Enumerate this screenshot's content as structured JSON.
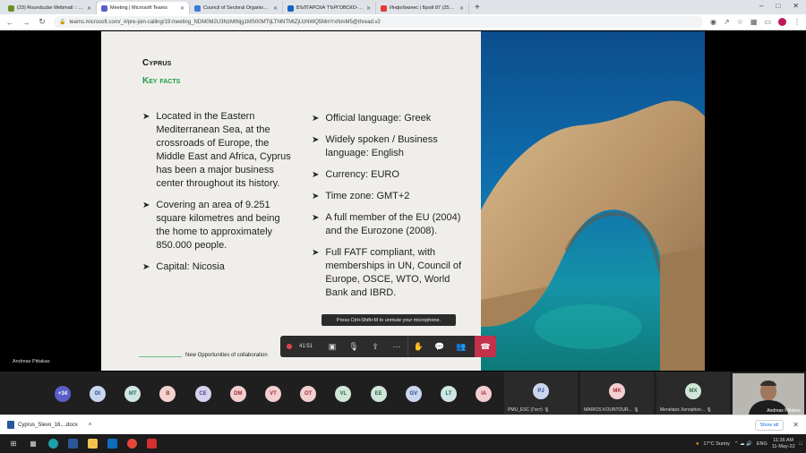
{
  "browser": {
    "tabs": [
      {
        "title": "(23) Roundcube Webmail :: Inbox",
        "color": "#6b8e23"
      },
      {
        "title": "Meeting | Microsoft Teams",
        "color": "#5b5fc7",
        "active": true
      },
      {
        "title": "Council of Sectoral Organisation...",
        "color": "#3a7bd5"
      },
      {
        "title": "БЪЛГАРСКА ТЪРГОВСКО-ПРОМ...",
        "color": "#1565c0"
      },
      {
        "title": "Инфобизнес | Брой 87 (2591) - ...",
        "color": "#e53935"
      }
    ],
    "new_tab": "+",
    "url": "teams.microsoft.com/_#/pre-join-calling/19:meeting_NDM0M2U3NzMtNjg1MS00MTljLThlNTMtZjUzNWQ5MmYxNmM5@thread.v2"
  },
  "slide": {
    "title": "Cyprus",
    "subtitle": "Key facts",
    "left_bullets": [
      "Located in the Eastern Mediterranean Sea, at the crossroads of Europe, the Middle East and Africa, Cyprus has been a major business center throughout its history.",
      "Covering an area of 9.251 square kilometres and being the home to approximately 850.000 people.",
      "Capital: Nicosia"
    ],
    "right_bullets": [
      "Official language: Greek",
      "Widely spoken / Business language: English",
      "Currency: EURO",
      "Time zone: GMT+2",
      "A full member of the EU (2004) and the Eurozone (2008).",
      "Full FATF compliant, with memberships in UN, Council of Europe, OSCE, WTO, World Bank and IBRD."
    ],
    "footer": "New Opportunities of collaboration"
  },
  "presenter_name": "Andreas Pittakas",
  "meeting": {
    "tooltip": "Press Ctrl+Shift+M to unmute your microphone.",
    "timer": "41:51"
  },
  "participants": {
    "overflow": "+34",
    "avatars": [
      {
        "initials": "DI",
        "bg": "#c9d6ee",
        "fg": "#2a4a8a"
      },
      {
        "initials": "MT",
        "bg": "#cfe6e3",
        "fg": "#1f6d64"
      },
      {
        "initials": "B",
        "bg": "#f2d3cf",
        "fg": "#9a3b2e"
      },
      {
        "initials": "CE",
        "bg": "#d7d3ee",
        "fg": "#4b3f94"
      },
      {
        "initials": "DM",
        "bg": "#f4cfd0",
        "fg": "#a0303a"
      },
      {
        "initials": "VT",
        "bg": "#f4cfd0",
        "fg": "#a0303a"
      },
      {
        "initials": "OT",
        "bg": "#f4cfd0",
        "fg": "#a0303a"
      },
      {
        "initials": "VL",
        "bg": "#cfe6d8",
        "fg": "#2b6d45"
      },
      {
        "initials": "EE",
        "bg": "#cfe6d8",
        "fg": "#2b6d45"
      },
      {
        "initials": "GV",
        "bg": "#c9d6ee",
        "fg": "#2a4a8a"
      },
      {
        "initials": "LT",
        "bg": "#cfe6e3",
        "fg": "#1f6d64"
      },
      {
        "initials": "IA",
        "bg": "#f4cfd0",
        "fg": "#a0303a"
      }
    ],
    "tiles": [
      {
        "initials": "PJ",
        "name": "PMU_ESC (Гост)",
        "bg": "#c9d6ee",
        "fg": "#2a4a8a"
      },
      {
        "initials": "MK",
        "name": "MARIOS KOUNTOUR...",
        "bg": "#f4cfd0",
        "fg": "#a0303a"
      },
      {
        "initials": "MX",
        "name": "Menelaos Xenophon...",
        "bg": "#cfe6d8",
        "fg": "#2b6d45"
      }
    ],
    "self_name": "Andreas Pittakas"
  },
  "download": {
    "file": "Cyprus_Slevo_16....docx",
    "show_all": "Show all"
  },
  "taskbar": {
    "weather": "17°C  Sunny",
    "lang": "ENG",
    "time": "11:36 AM",
    "date": "11-May-22"
  }
}
